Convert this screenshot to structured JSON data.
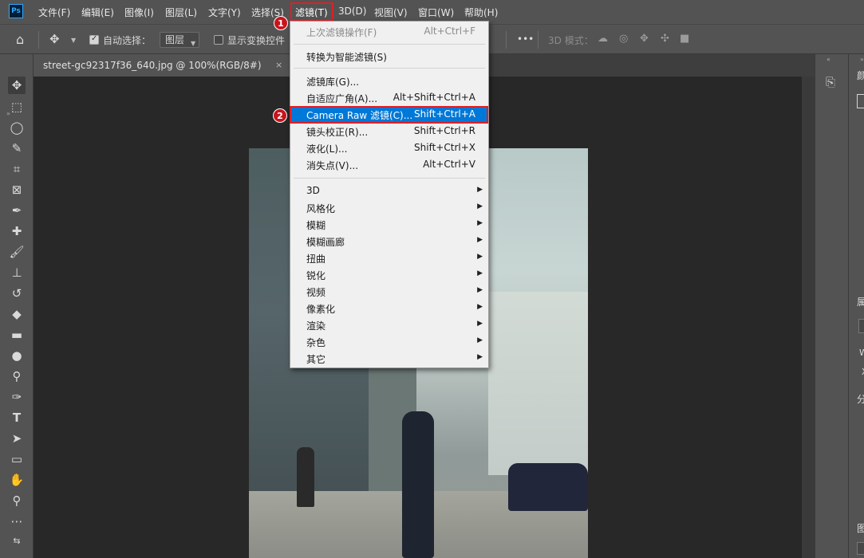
{
  "app": {
    "logo": "Ps"
  },
  "menubar": {
    "items": [
      "文件(F)",
      "编辑(E)",
      "图像(I)",
      "图层(L)",
      "文字(Y)",
      "选择(S)",
      "滤镜(T)",
      "3D(D)",
      "视图(V)",
      "窗口(W)",
      "帮助(H)"
    ]
  },
  "annotations": {
    "badge1": "1",
    "badge2": "2"
  },
  "optionsbar": {
    "auto_select_label": "自动选择：",
    "auto_select_checked": true,
    "layer_select_value": "图层",
    "show_transform_label": "显示变换控件",
    "show_transform_checked": false,
    "mode_3d_label": "3D 模式：",
    "more_label": "•••"
  },
  "document": {
    "tab_title": "street-gc92317f36_640.jpg @ 100%(RGB/8#)",
    "close_glyph": "×"
  },
  "filter_menu": {
    "items": [
      {
        "label": "上次滤镜操作(F)",
        "shortcut": "Alt+Ctrl+F",
        "disabled": true
      },
      {
        "label": "转换为智能滤镜(S)",
        "shortcut": ""
      },
      {
        "label": "滤镜库(G)...",
        "shortcut": ""
      },
      {
        "label": "自适应广角(A)...",
        "shortcut": "Alt+Shift+Ctrl+A"
      },
      {
        "label": "Camera Raw 滤镜(C)...",
        "shortcut": "Shift+Ctrl+A",
        "highlight": true
      },
      {
        "label": "镜头校正(R)...",
        "shortcut": "Shift+Ctrl+R"
      },
      {
        "label": "液化(L)...",
        "shortcut": "Shift+Ctrl+X"
      },
      {
        "label": "消失点(V)...",
        "shortcut": "Alt+Ctrl+V"
      },
      {
        "label": "3D",
        "submenu": true
      },
      {
        "label": "风格化",
        "submenu": true
      },
      {
        "label": "模糊",
        "submenu": true
      },
      {
        "label": "模糊画廊",
        "submenu": true
      },
      {
        "label": "扭曲",
        "submenu": true
      },
      {
        "label": "锐化",
        "submenu": true
      },
      {
        "label": "视频",
        "submenu": true
      },
      {
        "label": "像素化",
        "submenu": true
      },
      {
        "label": "渲染",
        "submenu": true
      },
      {
        "label": "杂色",
        "submenu": true
      },
      {
        "label": "其它",
        "submenu": true
      }
    ]
  },
  "right_panel": {
    "label_top": "颜",
    "label_mid": "属",
    "label_w": "W",
    "label_x": "X",
    "label_fen": "分",
    "label_bottom": "图"
  },
  "colors": {
    "menu_highlight": "#0078d7",
    "annotation_red": "#e01f26",
    "ui_gray": "#535353",
    "canvas_bg": "#282828"
  }
}
